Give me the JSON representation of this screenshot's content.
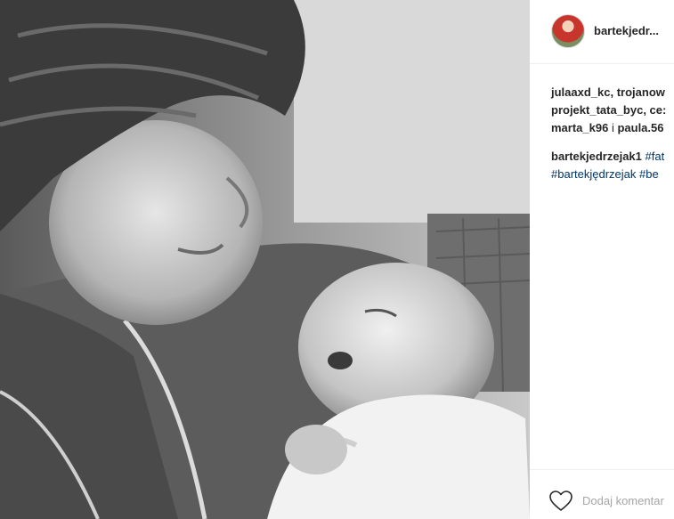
{
  "post": {
    "username": "bartekjedr...",
    "likes": {
      "line1": "julaaxd_kc, trojanow",
      "line2": "projekt_tata_byc, ce:",
      "line3_user1": "marta_k96",
      "line3_sep": " i ",
      "line3_user2": "paula.56"
    },
    "caption": {
      "author": "bartekjedrzejak1",
      "tag1": "#fat",
      "tag2": "#bartekjędrzejak",
      "tag3": "#be"
    },
    "comment_placeholder": "Dodaj komentar"
  },
  "icons": {
    "like": "heart-icon"
  },
  "colors": {
    "hashtag": "#003569",
    "placeholder": "#a6a6a6",
    "border": "#efefef"
  }
}
